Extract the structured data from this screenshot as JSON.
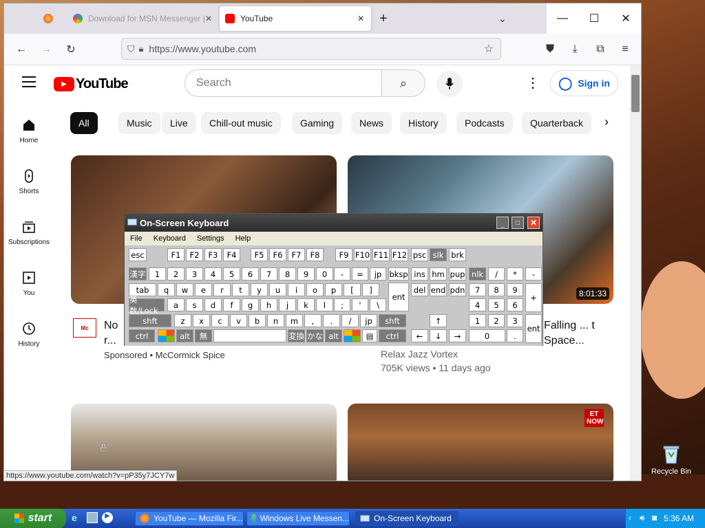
{
  "browser": {
    "tabs": [
      {
        "label": ""
      },
      {
        "label": "Download for MSN Messenger | ..."
      },
      {
        "label": "YouTube"
      }
    ],
    "url": "https://www.youtube.com",
    "status_url": "https://www.youtube.com/watch?v=pP35y7JCY7w"
  },
  "youtube": {
    "logo_text": "YouTube",
    "search_placeholder": "Search",
    "sign_in": "Sign in",
    "sidebar": [
      {
        "label": "Home",
        "icon": "home-icon"
      },
      {
        "label": "Shorts",
        "icon": "shorts-icon"
      },
      {
        "label": "Subscriptions",
        "icon": "subscriptions-icon"
      },
      {
        "label": "You",
        "icon": "you-icon"
      },
      {
        "label": "History",
        "icon": "history-icon"
      }
    ],
    "chips": [
      "All",
      "Music",
      "Live",
      "Chill-out music",
      "Gaming",
      "News",
      "History",
      "Podcasts",
      "Quarterback"
    ],
    "videos": [
      {
        "title": "No r... McC...",
        "meta": "Sponsored • McCormick Spice",
        "channel_badge": "McCormick"
      },
      {
        "title": "Falling ... t Space...",
        "channel": "Relax Jazz Vortex",
        "meta": "705K views • 11 days ago",
        "duration": "8:01:33"
      }
    ],
    "thumb_badge": "ET NOW"
  },
  "osk": {
    "title": "On-Screen Keyboard",
    "menu": [
      "File",
      "Keyboard",
      "Settings",
      "Help"
    ],
    "rows": {
      "r1": [
        "esc",
        "F1",
        "F2",
        "F3",
        "F4",
        "F5",
        "F6",
        "F7",
        "F8",
        "F9",
        "F10",
        "F11",
        "F12",
        "psc",
        "slk",
        "brk"
      ],
      "r2": [
        "漢字",
        "1",
        "2",
        "3",
        "4",
        "5",
        "6",
        "7",
        "8",
        "9",
        "0",
        "-",
        "=",
        "jp",
        "bksp",
        "ins",
        "hm",
        "pup",
        "nlk",
        "/",
        "*",
        "-"
      ],
      "r3": [
        "tab",
        "q",
        "w",
        "e",
        "r",
        "t",
        "y",
        "u",
        "i",
        "o",
        "p",
        "[",
        "]",
        "del",
        "end",
        "pdn",
        "7",
        "8",
        "9",
        "+"
      ],
      "r4": [
        "英数/Lock",
        "a",
        "s",
        "d",
        "f",
        "g",
        "h",
        "j",
        "k",
        "l",
        ";",
        "'",
        "\\",
        "ent",
        "4",
        "5",
        "6"
      ],
      "r5": [
        "shft",
        "z",
        "x",
        "c",
        "v",
        "b",
        "n",
        "m",
        ",",
        ".",
        "/",
        "jp",
        "shft",
        "↑",
        "1",
        "2",
        "3",
        "ent"
      ],
      "r6": [
        "ctrl",
        "",
        "alt",
        "無",
        "",
        "変換",
        "かな",
        "alt",
        "",
        "",
        "ctrl",
        "←",
        "↓",
        "→",
        "0",
        "."
      ]
    }
  },
  "desktop": {
    "recycle_bin": "Recycle Bin"
  },
  "taskbar": {
    "start": "start",
    "items": [
      "YouTube — Mozilla Fir...",
      "Windows Live Messen...",
      "On-Screen Keyboard"
    ],
    "clock": "5:36 AM"
  }
}
